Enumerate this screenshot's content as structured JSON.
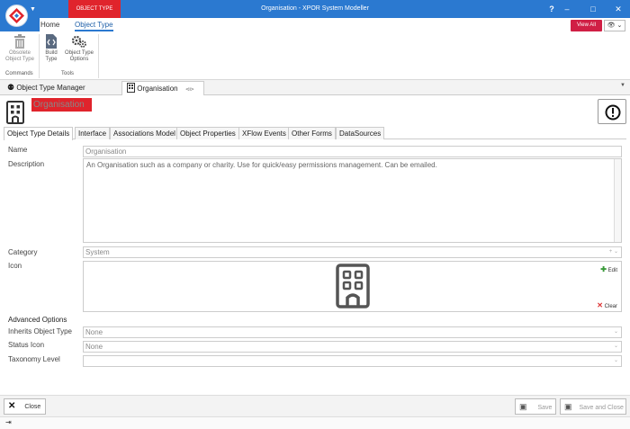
{
  "titlebar": {
    "context_tab": "OBJECT TYPE",
    "window_title": "Organisation - XPOR System Modeller",
    "help": "?",
    "minimize": "–",
    "maximize": "□",
    "close": "✕"
  },
  "ribbon_tabs": {
    "home": "Home",
    "object_type": "Object Type",
    "view_all": "View All",
    "eye": "👁 ⌄"
  },
  "ribbon": {
    "obsolete_line1": "Obsolete",
    "obsolete_line2": "Object Type",
    "build_line1": "Build",
    "build_line2": "Type",
    "options_line1": "Object Type",
    "options_line2": "Options",
    "group_commands": "Commands",
    "group_tools": "Tools"
  },
  "doc_tabs": {
    "manager": "Object Type Manager",
    "organisation": "Organisation",
    "pin": "⊲⊳",
    "close": "✕"
  },
  "header": {
    "title": "Organisation"
  },
  "inner_tabs": {
    "details": "Object Type Details",
    "interface": "Interface",
    "associations": "Associations Model",
    "properties": "Object Properties",
    "xflow": "XFlow Events",
    "forms": "Other Forms",
    "datasources": "DataSources"
  },
  "form": {
    "name_label": "Name",
    "name_value": "Organisation",
    "description_label": "Description",
    "description_value": "An Organisation such as a company or charity. Use for quick/easy permissions management. Can be emailed.",
    "category_label": "Category",
    "category_value": "System",
    "icon_label": "Icon",
    "edit_label": "Edit",
    "clear_label": "Clear",
    "advanced_title": "Advanced Options",
    "inherits_label": "Inherits Object Type",
    "inherits_value": "None",
    "status_icon_label": "Status Icon",
    "status_icon_value": "None",
    "taxonomy_label": "Taxonomy Level",
    "taxonomy_value": ""
  },
  "footer": {
    "close": "Close",
    "save": "Save",
    "save_close": "Save and Close"
  },
  "colors": {
    "title_blue": "#2b79d0",
    "accent_red": "#e0242c",
    "view_all": "#d01f45"
  }
}
